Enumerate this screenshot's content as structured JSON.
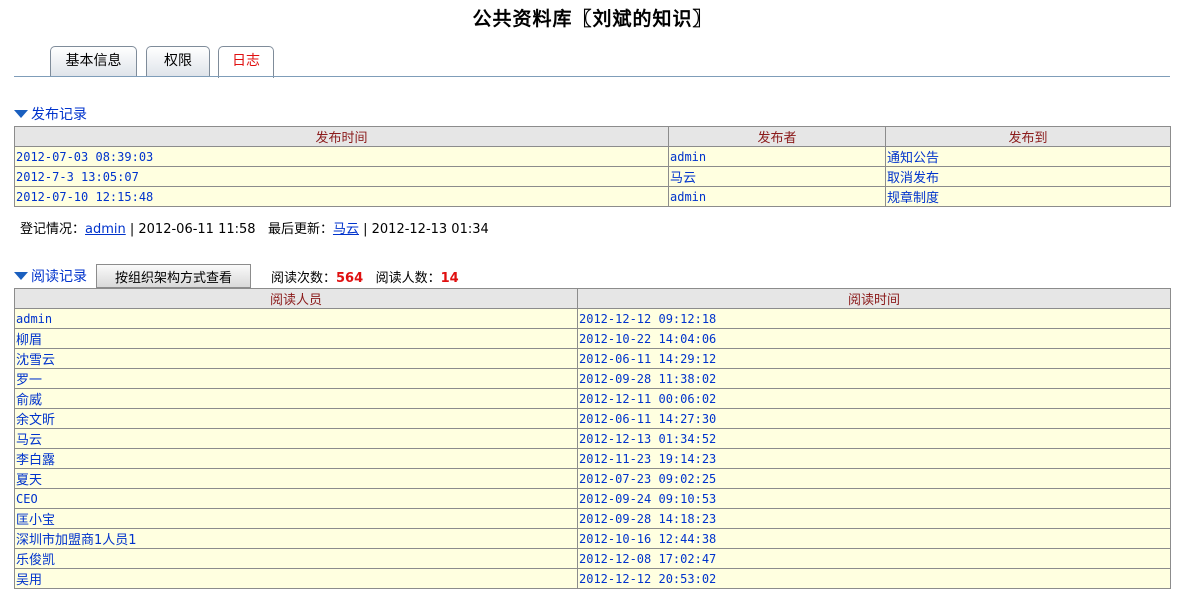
{
  "page": {
    "title": "公共资料库〖刘斌的知识〗"
  },
  "tabs": [
    {
      "label": "基本信息"
    },
    {
      "label": "权限"
    },
    {
      "label": "日志"
    }
  ],
  "publish": {
    "section_label": "发布记录",
    "headers": [
      "发布时间",
      "发布者",
      "发布到"
    ],
    "rows": [
      [
        "2012-07-03 08:39:03",
        "admin",
        "通知公告"
      ],
      [
        "2012-7-3 13:05:07",
        "马云",
        "取消发布"
      ],
      [
        "2012-07-10 12:15:48",
        "admin",
        "规章制度"
      ]
    ]
  },
  "registration": {
    "label": "登记情况：",
    "user": "admin",
    "time": " | 2012-06-11 11:58",
    "update_label": "最后更新：",
    "update_user": "马云",
    "update_time": " | 2012-12-13 01:34"
  },
  "reading": {
    "section_label": "阅读记录",
    "org_button": "按组织架构方式查看",
    "count_label": "阅读次数：",
    "count": "564",
    "people_label": "阅读人数：",
    "people": "14",
    "headers": [
      "阅读人员",
      "阅读时间"
    ],
    "rows": [
      [
        "admin",
        "2012-12-12 09:12:18"
      ],
      [
        "柳眉",
        "2012-10-22 14:04:06"
      ],
      [
        "沈雪云",
        "2012-06-11 14:29:12"
      ],
      [
        "罗一",
        "2012-09-28 11:38:02"
      ],
      [
        "俞威",
        "2012-12-11 00:06:02"
      ],
      [
        "余文昕",
        "2012-06-11 14:27:30"
      ],
      [
        "马云",
        "2012-12-13 01:34:52"
      ],
      [
        "李白露",
        "2012-11-23 19:14:23"
      ],
      [
        "夏天",
        "2012-07-23 09:02:25"
      ],
      [
        "CEO",
        "2012-09-24 09:10:53"
      ],
      [
        "匡小宝",
        "2012-09-28 14:18:23"
      ],
      [
        "深圳市加盟商1人员1",
        "2012-10-16 12:44:38"
      ],
      [
        "乐俊凯",
        "2012-12-08 17:02:47"
      ],
      [
        "吴用",
        "2012-12-12 20:53:02"
      ]
    ]
  }
}
